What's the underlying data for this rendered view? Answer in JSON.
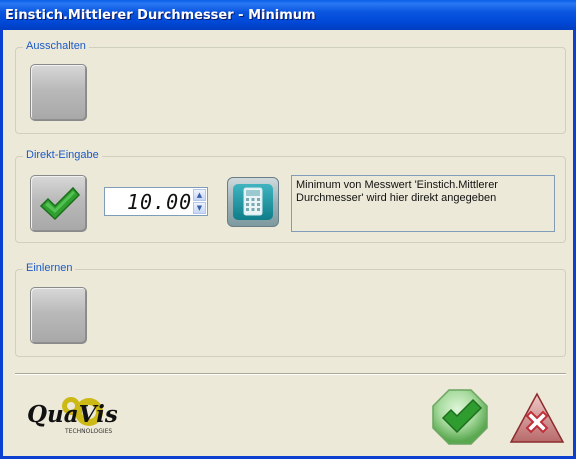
{
  "window": {
    "title": "Einstich.Mittlerer Durchmesser - Minimum"
  },
  "groups": {
    "ausschalten": {
      "label": "Ausschalten"
    },
    "direkt": {
      "label": "Direkt-Eingabe",
      "value": "10.00",
      "info": "Minimum von Messwert 'Einstich.Mittlerer Durchmesser' wird hier direkt angegeben"
    },
    "einlernen": {
      "label": "Einlernen"
    }
  },
  "logo": {
    "text": "QuaVis",
    "subtext": "TECHNOLOGIES"
  },
  "icons": {
    "check": "check-icon",
    "calculator": "calculator-icon",
    "ok": "ok-check-icon",
    "cancel": "cancel-x-icon"
  },
  "colors": {
    "title_bar": "#0054e3",
    "group_label": "#1a5ac8",
    "check_green": "#2fa02f",
    "cancel_red": "#c0303a"
  }
}
